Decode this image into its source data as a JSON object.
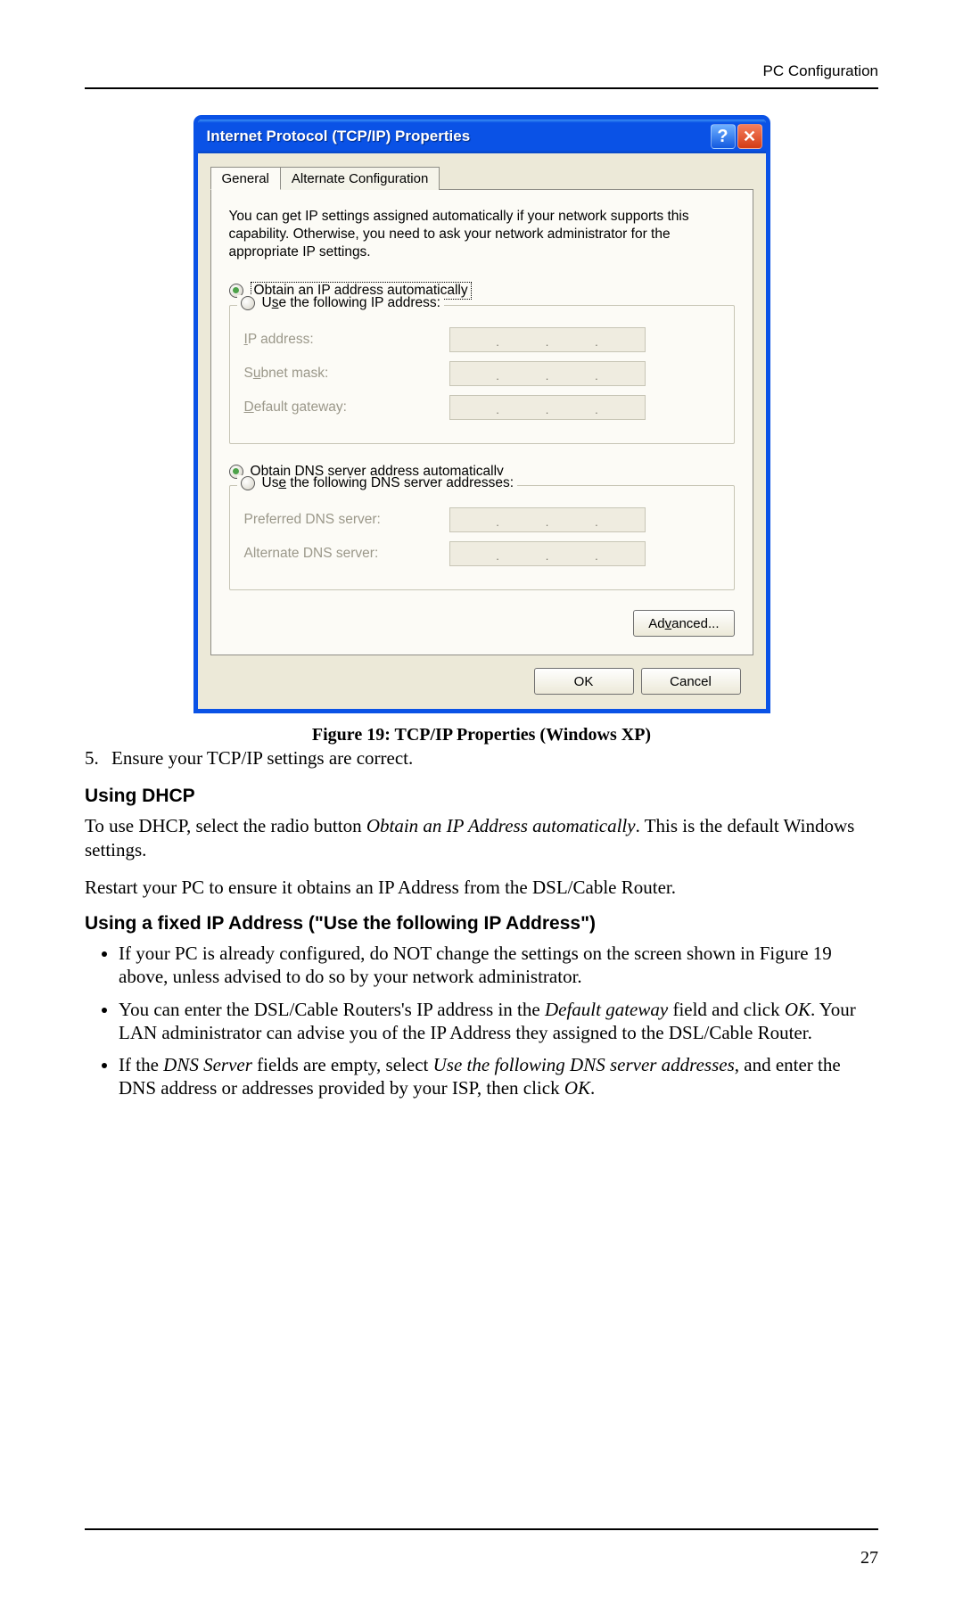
{
  "header": {
    "section": "PC Configuration"
  },
  "page_number": "27",
  "dialog": {
    "title": "Internet Protocol (TCP/IP) Properties",
    "help_glyph": "?",
    "close_glyph": "✕",
    "tabs": {
      "general": "General",
      "alt": "Alternate Configuration"
    },
    "desc": "You can get IP settings assigned automatically if your network supports this capability. Otherwise, you need to ask your network administrator for the appropriate IP settings.",
    "radio1_pre": "O",
    "radio1_rest": "btain an IP address automatically",
    "radio2_pre": "U",
    "radio2_mid": "s",
    "radio2_rest": "e the following IP address:",
    "ip_label_pre": "I",
    "ip_label_rest": "P address:",
    "subnet_pre": "S",
    "subnet_mid": "u",
    "subnet_rest": "bnet mask:",
    "gateway_pre": "D",
    "gateway_rest": "efault gateway:",
    "radio3_pre": "O",
    "radio3_mid": "b",
    "radio3_rest": "tain DNS server address automatically",
    "radio4_pre": "Us",
    "radio4_mid": "e",
    "radio4_rest": " the following DNS server addresses:",
    "pref_dns": "Preferred DNS server:",
    "alt_dns": "Alternate DNS server:",
    "advanced_pre": "Ad",
    "advanced_mid": "v",
    "advanced_rest": "anced...",
    "ok": "OK",
    "cancel": "Cancel",
    "ip_dot": "."
  },
  "figure_caption": "Figure 19: TCP/IP Properties (Windows XP)",
  "step5_num": "5.",
  "step5_text": "Ensure your TCP/IP settings are correct.",
  "h_dhcp": "Using DHCP",
  "p_dhcp_a": "To use DHCP, select the radio button ",
  "p_dhcp_it": "Obtain an IP Address automatically",
  "p_dhcp_b": ". This is the default Windows settings.",
  "p_restart": "Restart your PC to ensure it obtains an IP Address from the DSL/Cable Router.",
  "h_fixed": "Using a fixed IP Address (\"Use the following IP Address\")",
  "b1": "If your PC is already configured, do NOT change the settings on the screen shown in Figure 19 above, unless advised to do so by your network administrator.",
  "b2_a": "You can enter the DSL/Cable Routers's IP address in the ",
  "b2_it1": "Default gateway",
  "b2_b": " field and click ",
  "b2_it2": "OK",
  "b2_c": ". Your LAN administrator can advise you of the IP Address they assigned to the DSL/Cable Router.",
  "b3_a": "If the ",
  "b3_it1": "DNS Server",
  "b3_b": " fields are empty, select ",
  "b3_it2": "Use the following DNS server addresses",
  "b3_c": ", and enter the DNS address or addresses provided by your ISP, then click ",
  "b3_it3": "OK",
  "b3_d": "."
}
